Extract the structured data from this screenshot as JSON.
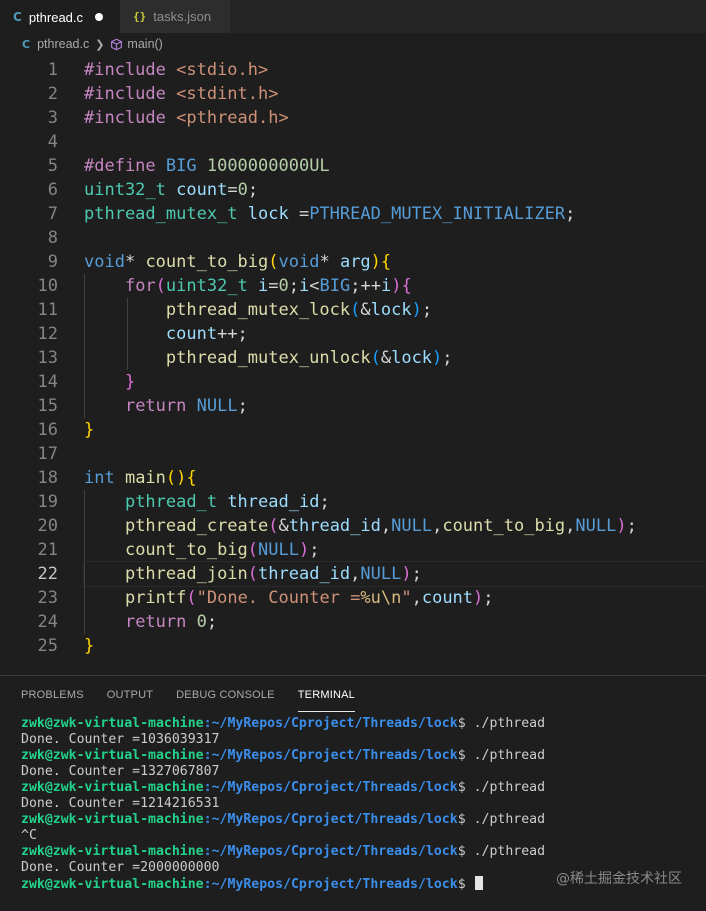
{
  "tabs": [
    {
      "icon": "C",
      "label": "pthread.c",
      "active": true,
      "modified": true
    },
    {
      "icon": "{}",
      "label": "tasks.json",
      "active": false
    }
  ],
  "breadcrumb": {
    "file_icon": "C",
    "file": "pthread.c",
    "symbol": "main()"
  },
  "editor": {
    "current_line": 22,
    "lines": [
      {
        "n": "1",
        "tokens": [
          [
            "pp",
            "#include "
          ],
          [
            "inc",
            "<stdio.h>"
          ]
        ]
      },
      {
        "n": "2",
        "tokens": [
          [
            "pp",
            "#include "
          ],
          [
            "inc",
            "<stdint.h>"
          ]
        ]
      },
      {
        "n": "3",
        "tokens": [
          [
            "pp",
            "#include "
          ],
          [
            "inc",
            "<pthread.h>"
          ]
        ]
      },
      {
        "n": "4",
        "tokens": []
      },
      {
        "n": "5",
        "tokens": [
          [
            "pp",
            "#define "
          ],
          [
            "def",
            "BIG "
          ],
          [
            "num",
            "1000000000UL"
          ]
        ]
      },
      {
        "n": "6",
        "tokens": [
          [
            "type",
            "uint32_t "
          ],
          [
            "var",
            "count"
          ],
          [
            "p",
            "="
          ],
          [
            "num",
            "0"
          ],
          [
            "p",
            ";"
          ]
        ]
      },
      {
        "n": "7",
        "tokens": [
          [
            "type",
            "pthread_mutex_t "
          ],
          [
            "var",
            "lock "
          ],
          [
            "p",
            "="
          ],
          [
            "def",
            "PTHREAD_MUTEX_INITIALIZER"
          ],
          [
            "p",
            ";"
          ]
        ]
      },
      {
        "n": "8",
        "tokens": []
      },
      {
        "n": "9",
        "tokens": [
          [
            "kw",
            "void"
          ],
          [
            "p",
            "* "
          ],
          [
            "fn",
            "count_to_big"
          ],
          [
            "b1",
            "("
          ],
          [
            "kw",
            "void"
          ],
          [
            "p",
            "* "
          ],
          [
            "var",
            "arg"
          ],
          [
            "b1",
            ")"
          ],
          [
            "b1",
            "{"
          ]
        ]
      },
      {
        "n": "10",
        "tokens": [
          [
            "p",
            "    "
          ],
          [
            "ctrl",
            "for"
          ],
          [
            "b2",
            "("
          ],
          [
            "type",
            "uint32_t "
          ],
          [
            "var",
            "i"
          ],
          [
            "p",
            "="
          ],
          [
            "num",
            "0"
          ],
          [
            "p",
            ";"
          ],
          [
            "var",
            "i"
          ],
          [
            "p",
            "<"
          ],
          [
            "def",
            "BIG"
          ],
          [
            "p",
            ";++"
          ],
          [
            "var",
            "i"
          ],
          [
            "b2",
            ")"
          ],
          [
            "b2",
            "{"
          ]
        ]
      },
      {
        "n": "11",
        "tokens": [
          [
            "p",
            "        "
          ],
          [
            "fn",
            "pthread_mutex_lock"
          ],
          [
            "b3",
            "("
          ],
          [
            "p",
            "&"
          ],
          [
            "var",
            "lock"
          ],
          [
            "b3",
            ")"
          ],
          [
            "p",
            ";"
          ]
        ]
      },
      {
        "n": "12",
        "tokens": [
          [
            "p",
            "        "
          ],
          [
            "var",
            "count"
          ],
          [
            "p",
            "++;"
          ]
        ]
      },
      {
        "n": "13",
        "tokens": [
          [
            "p",
            "        "
          ],
          [
            "fn",
            "pthread_mutex_unlock"
          ],
          [
            "b3",
            "("
          ],
          [
            "p",
            "&"
          ],
          [
            "var",
            "lock"
          ],
          [
            "b3",
            ")"
          ],
          [
            "p",
            ";"
          ]
        ]
      },
      {
        "n": "14",
        "tokens": [
          [
            "p",
            "    "
          ],
          [
            "b2",
            "}"
          ]
        ]
      },
      {
        "n": "15",
        "tokens": [
          [
            "p",
            "    "
          ],
          [
            "ctrl",
            "return "
          ],
          [
            "kw",
            "NULL"
          ],
          [
            "p",
            ";"
          ]
        ]
      },
      {
        "n": "16",
        "tokens": [
          [
            "b1",
            "}"
          ]
        ]
      },
      {
        "n": "17",
        "tokens": []
      },
      {
        "n": "18",
        "tokens": [
          [
            "kw",
            "int "
          ],
          [
            "fn",
            "main"
          ],
          [
            "b1",
            "()"
          ],
          [
            "b1",
            "{"
          ]
        ]
      },
      {
        "n": "19",
        "tokens": [
          [
            "p",
            "    "
          ],
          [
            "type",
            "pthread_t "
          ],
          [
            "var",
            "thread_id"
          ],
          [
            "p",
            ";"
          ]
        ]
      },
      {
        "n": "20",
        "tokens": [
          [
            "p",
            "    "
          ],
          [
            "fn",
            "pthread_create"
          ],
          [
            "b2",
            "("
          ],
          [
            "p",
            "&"
          ],
          [
            "var",
            "thread_id"
          ],
          [
            "p",
            ","
          ],
          [
            "kw",
            "NULL"
          ],
          [
            "p",
            ","
          ],
          [
            "fn",
            "count_to_big"
          ],
          [
            "p",
            ","
          ],
          [
            "kw",
            "NULL"
          ],
          [
            "b2",
            ")"
          ],
          [
            "p",
            ";"
          ]
        ]
      },
      {
        "n": "21",
        "tokens": [
          [
            "p",
            "    "
          ],
          [
            "fn",
            "count_to_big"
          ],
          [
            "b2",
            "("
          ],
          [
            "kw",
            "NULL"
          ],
          [
            "b2",
            ")"
          ],
          [
            "p",
            ";"
          ]
        ]
      },
      {
        "n": "22",
        "tokens": [
          [
            "p",
            "    "
          ],
          [
            "fn",
            "pthread_join"
          ],
          [
            "b2",
            "("
          ],
          [
            "var",
            "thread_id"
          ],
          [
            "p",
            ","
          ],
          [
            "kw",
            "NULL"
          ],
          [
            "b2",
            ")"
          ],
          [
            "p",
            ";"
          ]
        ]
      },
      {
        "n": "23",
        "tokens": [
          [
            "p",
            "    "
          ],
          [
            "fn",
            "printf"
          ],
          [
            "b2",
            "("
          ],
          [
            "str",
            "\"Done. Counter ="
          ],
          [
            "esc",
            "%u\\n"
          ],
          [
            "str",
            "\""
          ],
          [
            "p",
            ","
          ],
          [
            "var",
            "count"
          ],
          [
            "b2",
            ")"
          ],
          [
            "p",
            ";"
          ]
        ]
      },
      {
        "n": "24",
        "tokens": [
          [
            "p",
            "    "
          ],
          [
            "ctrl",
            "return "
          ],
          [
            "num",
            "0"
          ],
          [
            "p",
            ";"
          ]
        ]
      },
      {
        "n": "25",
        "tokens": [
          [
            "b1",
            "}"
          ]
        ]
      }
    ]
  },
  "panel": {
    "tabs": [
      "PROBLEMS",
      "OUTPUT",
      "DEBUG CONSOLE",
      "TERMINAL"
    ],
    "active_tab": "TERMINAL"
  },
  "terminal": {
    "lines": [
      {
        "user": "zwk@zwk-virtual-machine",
        "path": ":~/MyRepos/Cproject/Threads/lock",
        "cmd": "$ ./pthread"
      },
      {
        "text": "Done. Counter =1036039317"
      },
      {
        "user": "zwk@zwk-virtual-machine",
        "path": ":~/MyRepos/Cproject/Threads/lock",
        "cmd": "$ ./pthread"
      },
      {
        "text": "Done. Counter =1327067807"
      },
      {
        "user": "zwk@zwk-virtual-machine",
        "path": ":~/MyRepos/Cproject/Threads/lock",
        "cmd": "$ ./pthread"
      },
      {
        "text": "Done. Counter =1214216531"
      },
      {
        "user": "zwk@zwk-virtual-machine",
        "path": ":~/MyRepos/Cproject/Threads/lock",
        "cmd": "$ ./pthread"
      },
      {
        "text": "^C"
      },
      {
        "user": "zwk@zwk-virtual-machine",
        "path": ":~/MyRepos/Cproject/Threads/lock",
        "cmd": "$ ./pthread"
      },
      {
        "text": "Done. Counter =2000000000"
      },
      {
        "user": "zwk@zwk-virtual-machine",
        "path": ":~/MyRepos/Cproject/Threads/lock",
        "cmd": "$ ",
        "cursor": true
      }
    ]
  },
  "watermark": "@稀土掘金技术社区"
}
